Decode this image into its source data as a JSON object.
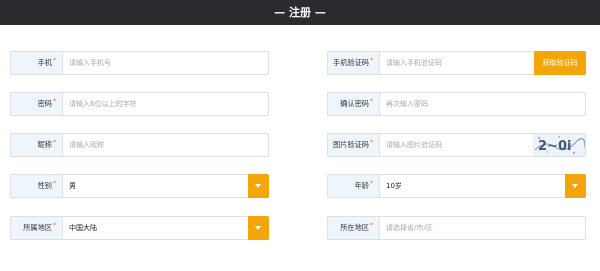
{
  "header": {
    "title": "— 注册 —"
  },
  "form": {
    "phone": {
      "label": "手机",
      "required_mark": "*",
      "placeholder": "请输入手机号"
    },
    "phone_code": {
      "label": "手机验证码",
      "required_mark": "*",
      "placeholder": "请输入手机验证码",
      "button": "获取验证码"
    },
    "password": {
      "label": "密码",
      "required_mark": "*",
      "placeholder": "请输入6位以上的字符"
    },
    "confirm_password": {
      "label": "确认密码",
      "required_mark": "*",
      "placeholder": "再次输入密码"
    },
    "nickname": {
      "label": "昵称",
      "required_mark": "*",
      "placeholder": "请输入昵称"
    },
    "image_code": {
      "label": "图片验证码",
      "required_mark": "*",
      "placeholder": "请输入图片验证码",
      "captcha_text": "2~0i"
    },
    "gender": {
      "label": "性别",
      "required_mark": "*",
      "value": "男"
    },
    "age": {
      "label": "年龄",
      "required_mark": "*",
      "value": "10岁"
    },
    "region": {
      "label": "所属地区",
      "required_mark": "*",
      "value": "中国大陆"
    },
    "location": {
      "label": "所在地区",
      "required_mark": "*",
      "placeholder": "请选择省/市/区"
    }
  },
  "colors": {
    "header_bg": "#2b2a2f",
    "accent": "#f4a50a",
    "label_bg": "#eef6fb",
    "required": "#ff6a00"
  }
}
